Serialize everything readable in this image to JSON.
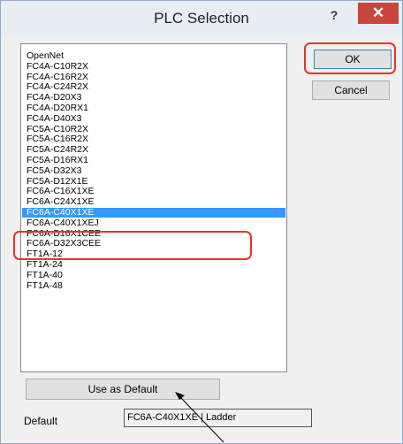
{
  "window": {
    "title": "PLC Selection",
    "help_label": "?",
    "close_label": "✕"
  },
  "list": {
    "items": [
      "OpenNet",
      "FC4A-C10R2X",
      "FC4A-C16R2X",
      "FC4A-C24R2X",
      "FC4A-D20X3",
      "FC4A-D20RX1",
      "FC4A-D40X3",
      "FC5A-C10R2X",
      "FC5A-C16R2X",
      "FC5A-C24R2X",
      "FC5A-D16RX1",
      "FC5A-D32X3",
      "FC5A-D12X1E",
      "FC6A-C16X1XE",
      "FC6A-C24X1XE",
      "FC6A-C40X1XE",
      "FC6A-C40X1XEJ",
      "FC6A-D16X1CEE",
      "FC6A-D32X3CEE",
      "FT1A-12",
      "FT1A-24",
      "FT1A-40",
      "FT1A-48"
    ],
    "selected_index": 15
  },
  "buttons": {
    "ok": "OK",
    "cancel": "Cancel",
    "use_default": "Use as Default"
  },
  "default": {
    "label": "Default",
    "value": "FC6A-C40X1XE | Ladder"
  },
  "colors": {
    "highlight": "#e8332e",
    "selection": "#3399ff",
    "close_button": "#c9463d"
  }
}
